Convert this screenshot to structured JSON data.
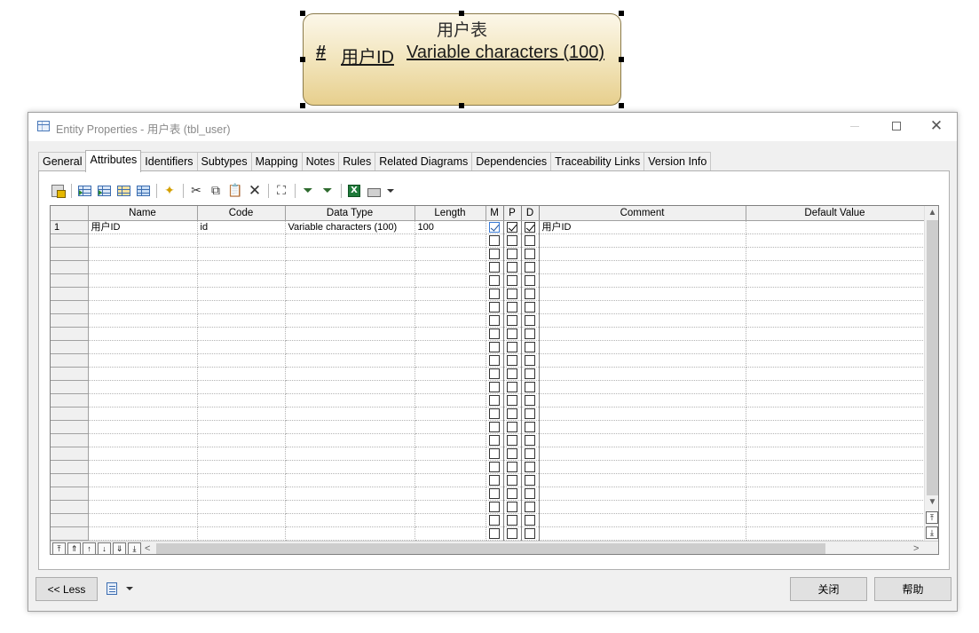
{
  "entity": {
    "title": "用户表",
    "attributes": [
      {
        "marker": "#",
        "name": "用户ID",
        "type": "Variable characters (100)"
      }
    ]
  },
  "dialog": {
    "title": "Entity Properties - 用户表 (tbl_user)",
    "window_buttons": {
      "minimize": "—",
      "maximize": "□",
      "close": "✕"
    },
    "tabs": [
      "General",
      "Attributes",
      "Identifiers",
      "Subtypes",
      "Mapping",
      "Notes",
      "Rules",
      "Related Diagrams",
      "Dependencies",
      "Traceability Links",
      "Version Info"
    ],
    "active_tab": "Attributes",
    "toolbar": {
      "icons": [
        "properties-icon",
        "add-row-icon",
        "insert-row-icon",
        "add-attributes-icon",
        "reuse-attributes-icon",
        "new-icon",
        "cut-icon",
        "copy-icon",
        "paste-icon",
        "delete-icon",
        "find-icon",
        "filter-icon",
        "filter-clear-icon",
        "excel-icon",
        "print-icon"
      ]
    },
    "grid": {
      "columns": [
        "Name",
        "Code",
        "Data Type",
        "Length",
        "M",
        "P",
        "D",
        "Comment",
        "Default Value"
      ],
      "rows": [
        {
          "num": "1",
          "name": "用户ID",
          "code": "id",
          "data_type": "Variable characters (100)",
          "length": "100",
          "m": true,
          "p": true,
          "d": true,
          "comment": "用户ID",
          "default": ""
        }
      ],
      "empty_rows": 23
    },
    "buttons": {
      "less": "<< Less",
      "close": "关闭",
      "help": "帮助"
    }
  }
}
